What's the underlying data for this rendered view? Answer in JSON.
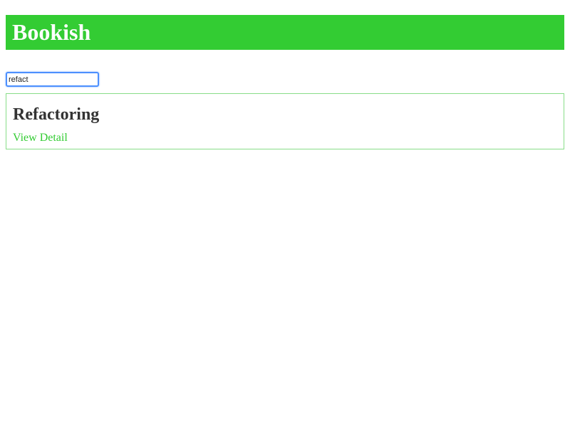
{
  "header": {
    "brand": "Bookish"
  },
  "search": {
    "value": "refact",
    "placeholder": ""
  },
  "results": [
    {
      "title": "Refactoring",
      "link_label": "View Detail"
    }
  ],
  "colors": {
    "accent": "#33cc33",
    "card_border": "#88dd88",
    "focus_ring": "#4d90fe",
    "text": "#333333"
  }
}
